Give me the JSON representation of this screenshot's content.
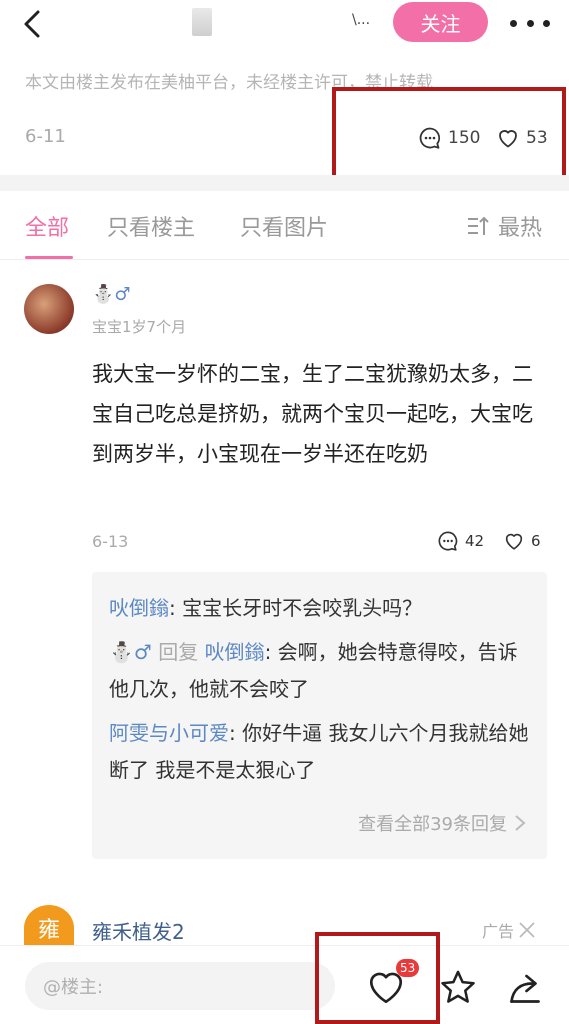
{
  "header": {
    "author_name": "\\...",
    "follow_label": "关注"
  },
  "post": {
    "copyright_notice": "本文由楼主发布在美柚平台，未经楼主许可，禁止转载",
    "date": "6-11",
    "comment_count": "150",
    "like_count": "53"
  },
  "filter_tabs": [
    {
      "label": "全部",
      "active": true
    },
    {
      "label": "只看楼主",
      "active": false
    },
    {
      "label": "只看图片",
      "active": false
    }
  ],
  "sort_label": "最热",
  "comment": {
    "username": "⛄♂",
    "baby_age": "宝宝1岁7个月",
    "text": "我大宝一岁怀的二宝，生了二宝犹豫奶太多，二宝自己吃总是挤奶，就两个宝贝一起吃，大宝吃到两岁半，小宝现在一岁半还在吃奶",
    "date": "6-13",
    "reply_count": "42",
    "like_count": "6",
    "replies": [
      {
        "name": "吙倒鎓",
        "text": "宝宝长牙时不会咬乳头吗？"
      },
      {
        "name": "⛄♂",
        "reply_word": "回复",
        "target": "吙倒鎓",
        "text": "会啊，她会特意得咬，告诉他几次，他就不会咬了"
      },
      {
        "name": "阿雯与小可爱",
        "text": "你好牛逼 我女儿六个月我就给她断了 我是不是太狠心了"
      }
    ],
    "view_all_label": "查看全部39条回复"
  },
  "ad": {
    "logo_text": "雍",
    "name": "雍禾植发2",
    "tag": "广告"
  },
  "bottom_bar": {
    "input_placeholder": "@楼主:",
    "like_badge": "53"
  },
  "colors": {
    "accent_pink": "#f26fa7",
    "username_blue": "#5c88c4",
    "highlight_red": "#b11a1a",
    "ad_orange": "#f29a1e"
  }
}
